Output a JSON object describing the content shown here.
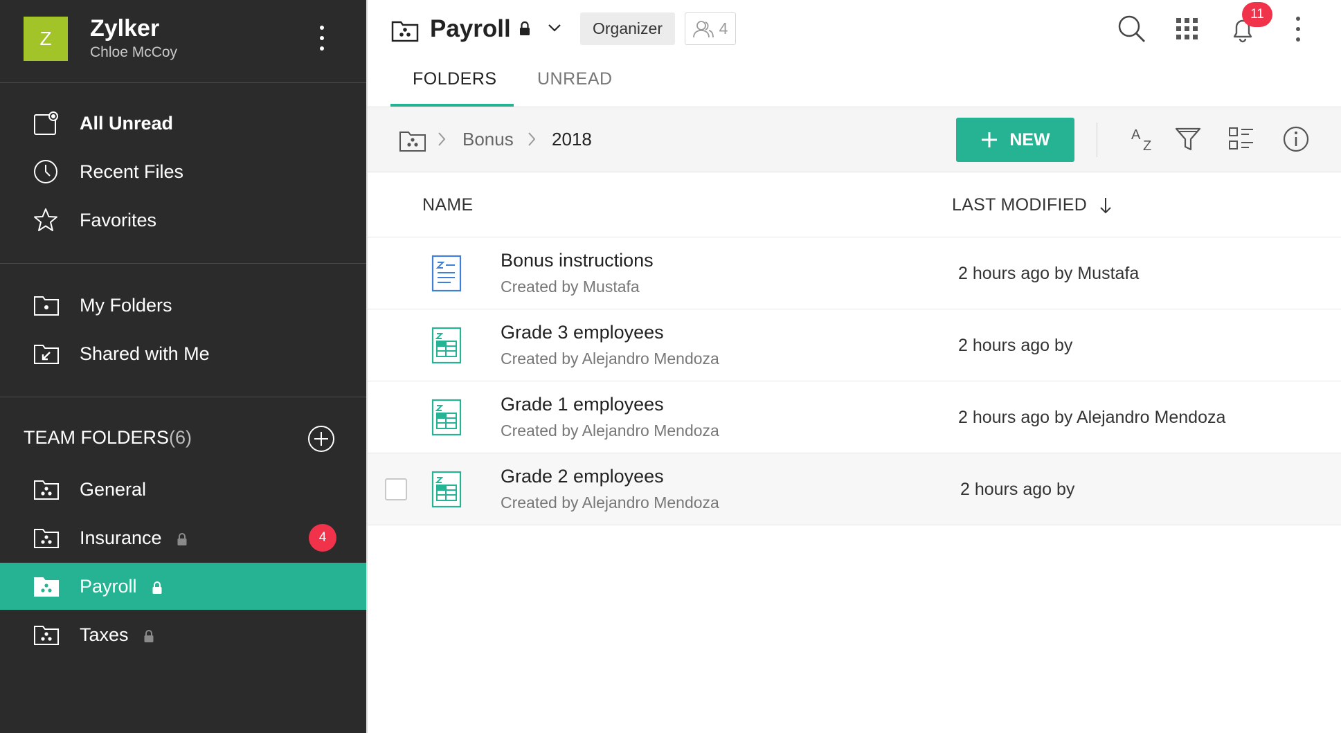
{
  "workspace": {
    "logo_letter": "Z",
    "name": "Zylker",
    "user": "Chloe McCoy"
  },
  "nav": {
    "top": [
      {
        "label": "All Unread",
        "icon": "unread-icon"
      },
      {
        "label": "Recent Files",
        "icon": "clock-icon"
      },
      {
        "label": "Favorites",
        "icon": "star-icon"
      }
    ],
    "personal": [
      {
        "label": "My Folders",
        "icon": "folder-icon"
      },
      {
        "label": "Shared with Me",
        "icon": "shared-folder-icon"
      }
    ],
    "team_header": "TEAM FOLDERS",
    "team_count": "(6)",
    "team": [
      {
        "label": "General",
        "locked": false
      },
      {
        "label": "Insurance",
        "locked": true,
        "badge": "4"
      },
      {
        "label": "Payroll",
        "locked": true,
        "active": true
      },
      {
        "label": "Taxes",
        "locked": true
      }
    ]
  },
  "header": {
    "title": "Payroll",
    "role": "Organizer",
    "members": "4",
    "notifications": "11",
    "tabs": [
      "FOLDERS",
      "UNREAD"
    ],
    "active_tab": "FOLDERS"
  },
  "toolbar": {
    "breadcrumb": [
      "Bonus",
      "2018"
    ],
    "new_label": "NEW"
  },
  "table": {
    "columns": {
      "name": "NAME",
      "modified": "LAST MODIFIED"
    },
    "rows": [
      {
        "name": "Bonus instructions",
        "sub": "Created by Mustafa",
        "modified": "2 hours ago by Mustafa",
        "type": "document"
      },
      {
        "name": "Grade 3 employees",
        "sub": "Created by Alejandro Mendoza",
        "modified": "2 hours ago by",
        "type": "spreadsheet"
      },
      {
        "name": "Grade 1 employees",
        "sub": "Created by Alejandro Mendoza",
        "modified": "2 hours ago by Alejandro Mendoza",
        "type": "spreadsheet"
      },
      {
        "name": "Grade 2 employees",
        "sub": "Created by Alejandro Mendoza",
        "modified": "2 hours ago by",
        "type": "spreadsheet"
      }
    ]
  },
  "colors": {
    "accent": "#26b393",
    "sidebar_bg": "#2b2b2b",
    "brand_logo": "#a3c429",
    "badge": "#f0334b",
    "doc_blue": "#3f7fd6"
  }
}
